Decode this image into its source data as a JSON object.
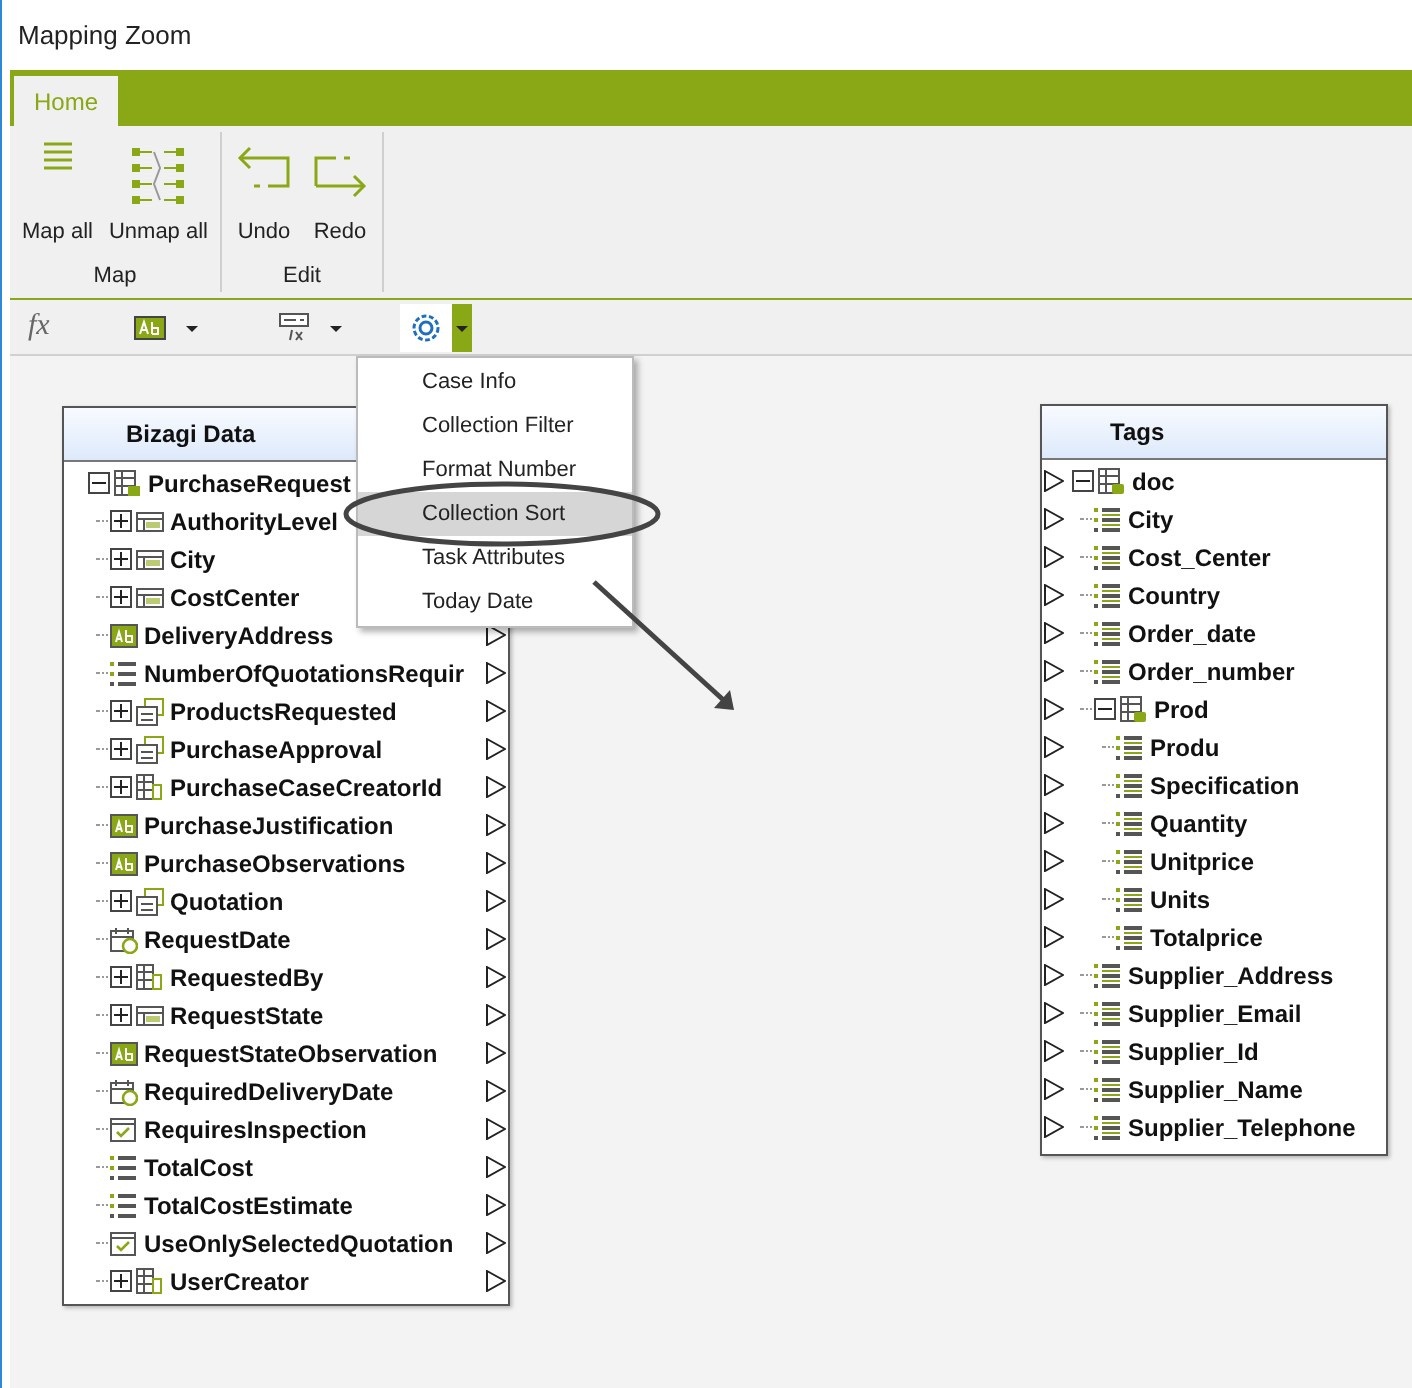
{
  "window": {
    "title": "Mapping Zoom"
  },
  "tabs": [
    {
      "label": "Home",
      "selected": true
    }
  ],
  "ribbon": {
    "groups": [
      {
        "label": "Map",
        "buttons": [
          {
            "label": "Map all",
            "kind": "mapall"
          },
          {
            "label": "Unmap all",
            "kind": "unmapall"
          }
        ]
      },
      {
        "label": "Edit",
        "buttons": [
          {
            "label": "Undo",
            "kind": "undo"
          },
          {
            "label": "Redo",
            "kind": "redo"
          }
        ]
      }
    ]
  },
  "toolbar": [
    {
      "kind": "fx",
      "label": "fx"
    },
    {
      "kind": "text",
      "dropdown": true,
      "open": false
    },
    {
      "kind": "tablefx",
      "dropdown": true,
      "open": false
    },
    {
      "kind": "gear",
      "dropdown": true,
      "open": true
    }
  ],
  "menu": {
    "items": [
      {
        "label": "Case Info",
        "selected": false
      },
      {
        "label": "Collection Filter",
        "selected": false
      },
      {
        "label": "Format Number",
        "selected": false
      },
      {
        "label": "Collection Sort",
        "selected": true
      },
      {
        "label": "Task Attributes",
        "selected": false
      },
      {
        "label": "Today Date",
        "selected": false
      }
    ]
  },
  "source_panel": {
    "title": "Bizagi Data",
    "tree": [
      {
        "label": "PurchaseRequest",
        "kind": "entity",
        "expanded": true,
        "children": [
          {
            "label": "AuthorityLevel",
            "kind": "param",
            "expanded": false
          },
          {
            "label": "City",
            "kind": "param",
            "expanded": false
          },
          {
            "label": "CostCenter",
            "kind": "param",
            "expanded": false
          },
          {
            "label": "DeliveryAddress",
            "kind": "text"
          },
          {
            "label": "NumberOfQuotationsRequir",
            "kind": "number"
          },
          {
            "label": "ProductsRequested",
            "kind": "collection",
            "expanded": false
          },
          {
            "label": "PurchaseApproval",
            "kind": "collection",
            "expanded": false
          },
          {
            "label": "PurchaseCaseCreatorId",
            "kind": "relation",
            "expanded": false
          },
          {
            "label": "PurchaseJustification",
            "kind": "text"
          },
          {
            "label": "PurchaseObservations",
            "kind": "text"
          },
          {
            "label": "Quotation",
            "kind": "collection",
            "expanded": false
          },
          {
            "label": "RequestDate",
            "kind": "date"
          },
          {
            "label": "RequestedBy",
            "kind": "relation",
            "expanded": false
          },
          {
            "label": "RequestState",
            "kind": "param",
            "expanded": false
          },
          {
            "label": "RequestStateObservation",
            "kind": "text"
          },
          {
            "label": "RequiredDeliveryDate",
            "kind": "date"
          },
          {
            "label": "RequiresInspection",
            "kind": "boolean"
          },
          {
            "label": "TotalCost",
            "kind": "number"
          },
          {
            "label": "TotalCostEstimate",
            "kind": "number"
          },
          {
            "label": "UseOnlySelectedQuotation",
            "kind": "boolean"
          },
          {
            "label": "UserCreator",
            "kind": "relation",
            "expanded": false
          }
        ]
      }
    ]
  },
  "target_panel": {
    "title": "Tags",
    "tree": [
      {
        "label": "doc",
        "kind": "element",
        "expanded": true,
        "children": [
          {
            "label": "City",
            "kind": "field"
          },
          {
            "label": "Cost_Center",
            "kind": "field"
          },
          {
            "label": "Country",
            "kind": "field"
          },
          {
            "label": "Order_date",
            "kind": "field"
          },
          {
            "label": "Order_number",
            "kind": "field"
          },
          {
            "label": "Prod",
            "kind": "element",
            "expanded": true,
            "children": [
              {
                "label": "Produ",
                "kind": "field"
              },
              {
                "label": "Specification",
                "kind": "field"
              },
              {
                "label": "Quantity",
                "kind": "field"
              },
              {
                "label": "Unitprice",
                "kind": "field"
              },
              {
                "label": "Units",
                "kind": "field"
              },
              {
                "label": "Totalprice",
                "kind": "field"
              }
            ]
          },
          {
            "label": "Supplier_Address",
            "kind": "field"
          },
          {
            "label": "Supplier_Email",
            "kind": "field"
          },
          {
            "label": "Supplier_Id",
            "kind": "field"
          },
          {
            "label": "Supplier_Name",
            "kind": "field"
          },
          {
            "label": "Supplier_Telephone",
            "kind": "field"
          }
        ]
      }
    ]
  }
}
